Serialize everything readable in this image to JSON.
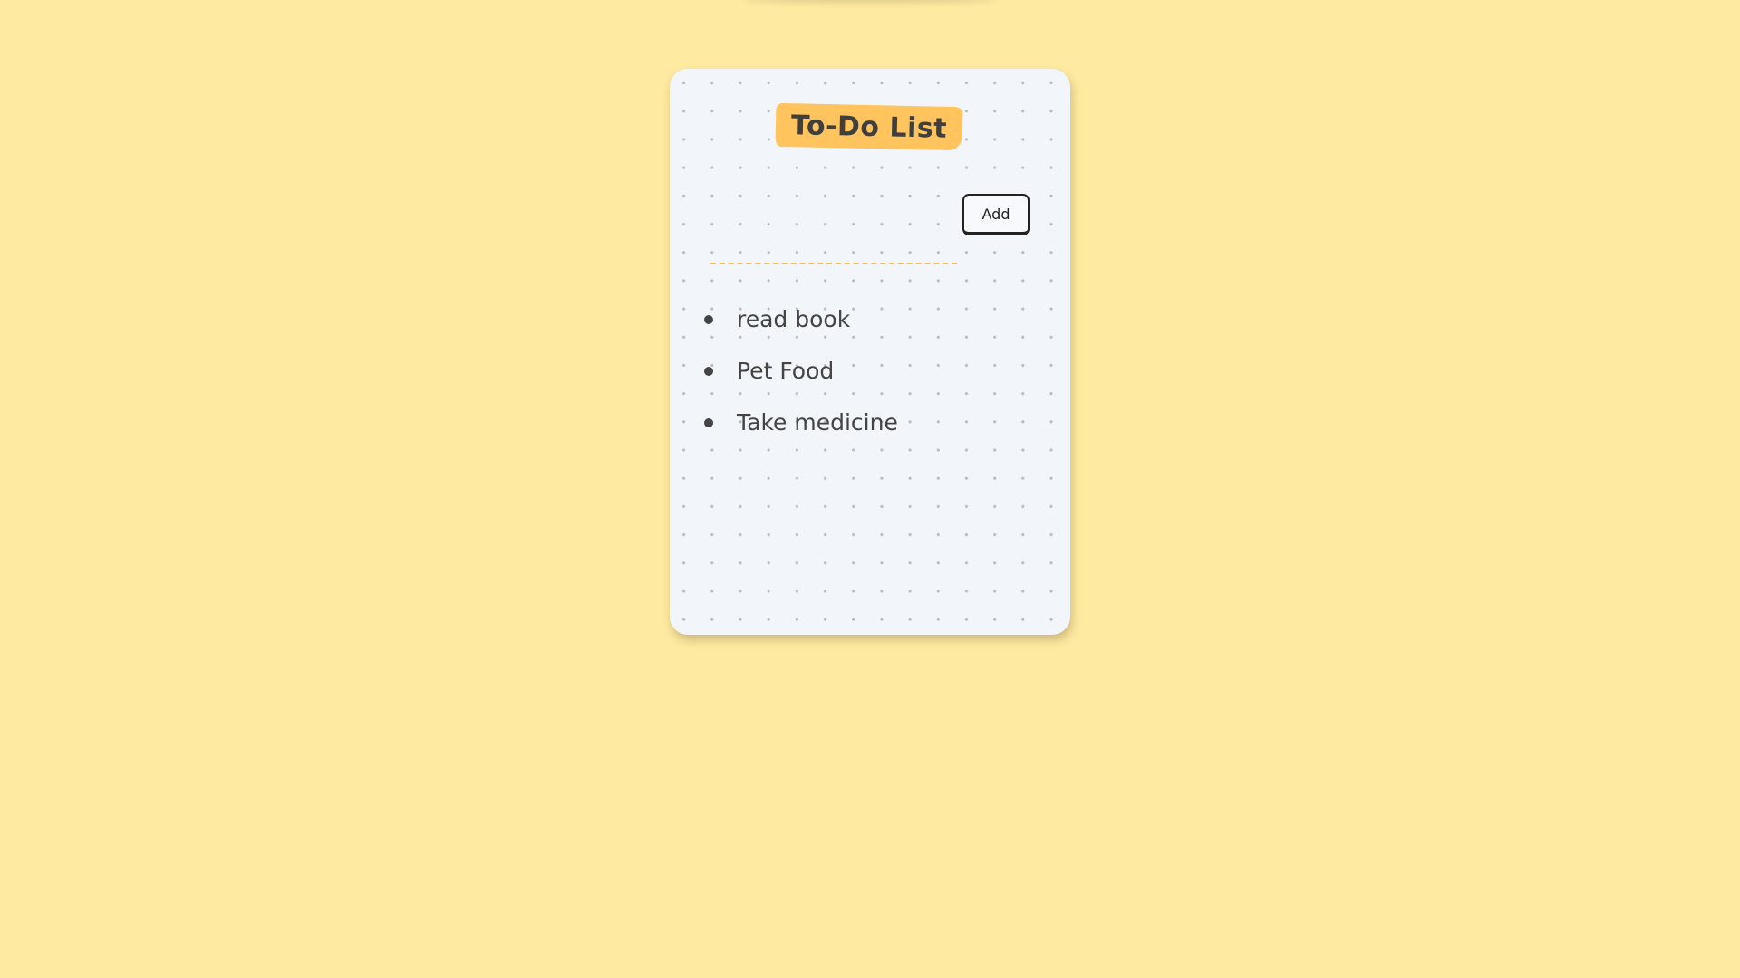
{
  "app": {
    "title": "To-Do List"
  },
  "input": {
    "value": "",
    "placeholder": ""
  },
  "buttons": {
    "add_label": "Add"
  },
  "tasks": [
    {
      "text": "read book"
    },
    {
      "text": "Pet Food"
    },
    {
      "text": "Take medicine"
    }
  ],
  "colors": {
    "page_background": "#ffeaa1",
    "card_background": "#f2f5f9",
    "title_highlight": "#ffc45e",
    "input_underline": "#f5c056",
    "text": "#444444"
  }
}
